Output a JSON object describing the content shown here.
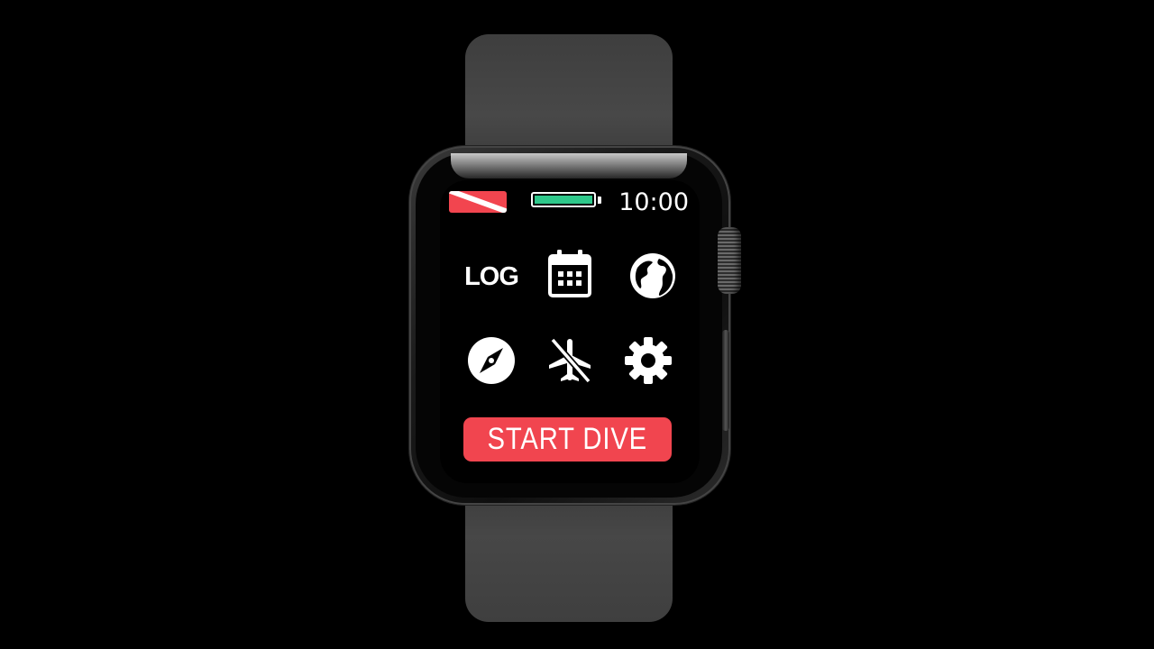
{
  "status_bar": {
    "dive_flag_icon": "dive-flag-icon",
    "battery_level_percent": 100,
    "time": "10:00"
  },
  "menu": {
    "items": [
      {
        "label": "LOG",
        "icon": "log-text-icon"
      },
      {
        "icon": "calendar-icon"
      },
      {
        "icon": "globe-icon"
      },
      {
        "icon": "compass-icon"
      },
      {
        "icon": "no-fly-icon"
      },
      {
        "icon": "gear-icon"
      }
    ]
  },
  "actions": {
    "start_dive_label": "START DIVE"
  },
  "colors": {
    "accent_red": "#f1454f",
    "battery_green": "#2fc88b",
    "background": "#000000",
    "strap": "#444444"
  }
}
